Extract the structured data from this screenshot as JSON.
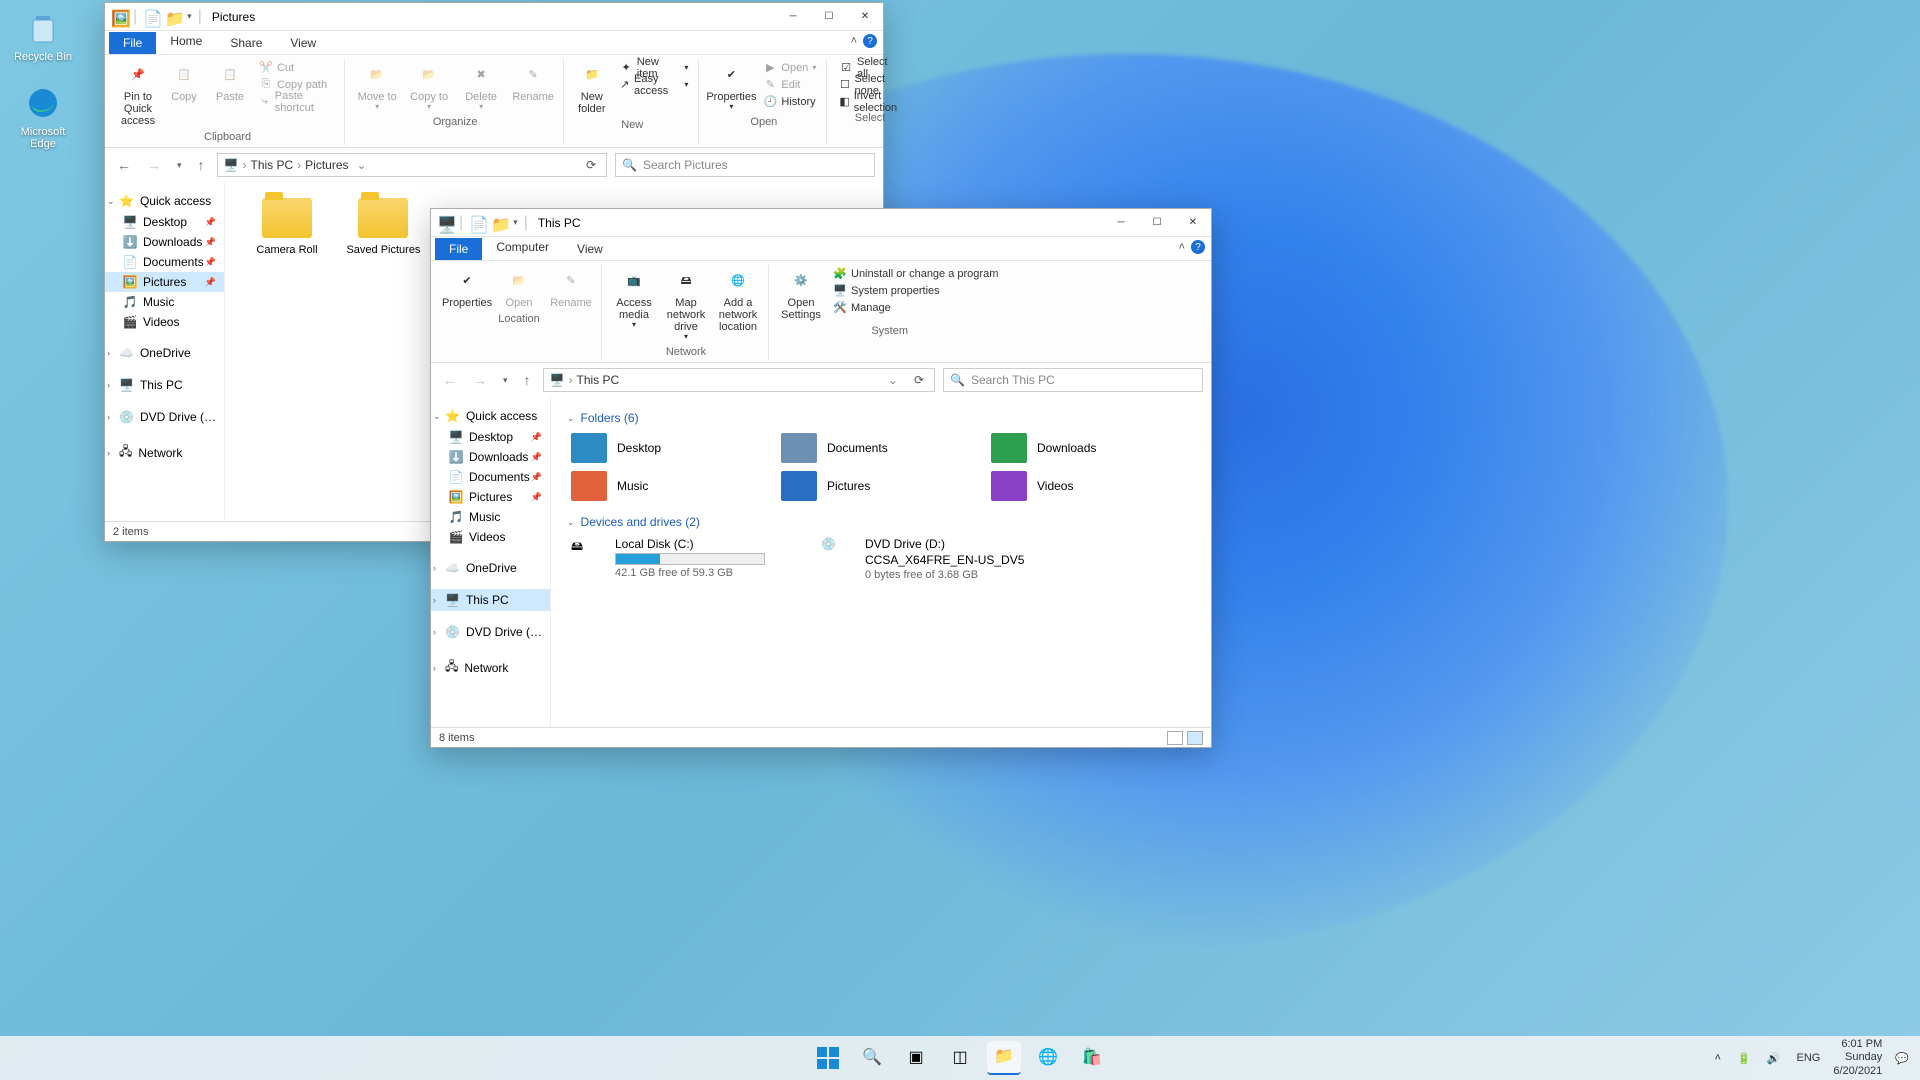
{
  "desktop": {
    "icons": [
      {
        "name": "recycle-bin",
        "label": "Recycle Bin"
      },
      {
        "name": "edge",
        "label": "Microsoft Edge"
      }
    ]
  },
  "window1": {
    "title": "Pictures",
    "tabs": {
      "file": "File",
      "home": "Home",
      "share": "Share",
      "view": "View"
    },
    "ribbon": {
      "clipboard": {
        "label": "Clipboard",
        "pin": "Pin to Quick access",
        "copy": "Copy",
        "paste": "Paste",
        "cut": "Cut",
        "copypath": "Copy path",
        "pasteshort": "Paste shortcut"
      },
      "organize": {
        "label": "Organize",
        "moveto": "Move to",
        "copyto": "Copy to",
        "delete": "Delete",
        "rename": "Rename"
      },
      "new": {
        "label": "New",
        "newfolder": "New folder",
        "newitem": "New item",
        "easyaccess": "Easy access"
      },
      "open": {
        "label": "Open",
        "properties": "Properties",
        "open": "Open",
        "edit": "Edit",
        "history": "History"
      },
      "select": {
        "label": "Select",
        "selectall": "Select all",
        "selectnone": "Select none",
        "invert": "Invert selection"
      }
    },
    "breadcrumb": {
      "root": "This PC",
      "leaf": "Pictures"
    },
    "search_placeholder": "Search Pictures",
    "nav": {
      "quickaccess": "Quick access",
      "items": [
        "Desktop",
        "Downloads",
        "Documents",
        "Pictures",
        "Music",
        "Videos"
      ],
      "onedrive": "OneDrive",
      "thispc": "This PC",
      "dvd": "DVD Drive (D:) CCSA",
      "network": "Network"
    },
    "folders": [
      "Camera Roll",
      "Saved Pictures"
    ],
    "status": "2 items"
  },
  "window2": {
    "title": "This PC",
    "tabs": {
      "file": "File",
      "computer": "Computer",
      "view": "View"
    },
    "ribbon": {
      "location": {
        "label": "Location",
        "properties": "Properties",
        "open": "Open",
        "rename": "Rename"
      },
      "network": {
        "label": "Network",
        "access": "Access media",
        "map": "Map network drive",
        "add": "Add a network location"
      },
      "system": {
        "label": "System",
        "settings": "Open Settings",
        "uninstall": "Uninstall or change a program",
        "sysprops": "System properties",
        "manage": "Manage"
      }
    },
    "breadcrumb": {
      "root": "This PC"
    },
    "search_placeholder": "Search This PC",
    "nav": {
      "quickaccess": "Quick access",
      "items": [
        "Desktop",
        "Downloads",
        "Documents",
        "Pictures",
        "Music",
        "Videos"
      ],
      "onedrive": "OneDrive",
      "thispc": "This PC",
      "dvd": "DVD Drive (D:) CCSA",
      "network": "Network"
    },
    "sections": {
      "folders": "Folders (6)",
      "drives": "Devices and drives (2)"
    },
    "folders": [
      {
        "name": "Desktop",
        "color": "#2b8cc4"
      },
      {
        "name": "Documents",
        "color": "#6d8fb3"
      },
      {
        "name": "Downloads",
        "color": "#2e9e4f"
      },
      {
        "name": "Music",
        "color": "#e0623a"
      },
      {
        "name": "Pictures",
        "color": "#2b6fc4"
      },
      {
        "name": "Videos",
        "color": "#8a3fc4"
      }
    ],
    "drives": [
      {
        "name": "Local Disk (C:)",
        "sub": "42.1 GB free of 59.3 GB",
        "fill": 30
      },
      {
        "name": "DVD Drive (D:)",
        "line2": "CCSA_X64FRE_EN-US_DV5",
        "sub": "0 bytes free of 3.68 GB"
      }
    ],
    "status": "8 items"
  },
  "taskbar": {
    "systray": {
      "lang": "ENG",
      "time": "6:01 PM",
      "day": "Sunday",
      "date": "6/20/2021"
    }
  }
}
